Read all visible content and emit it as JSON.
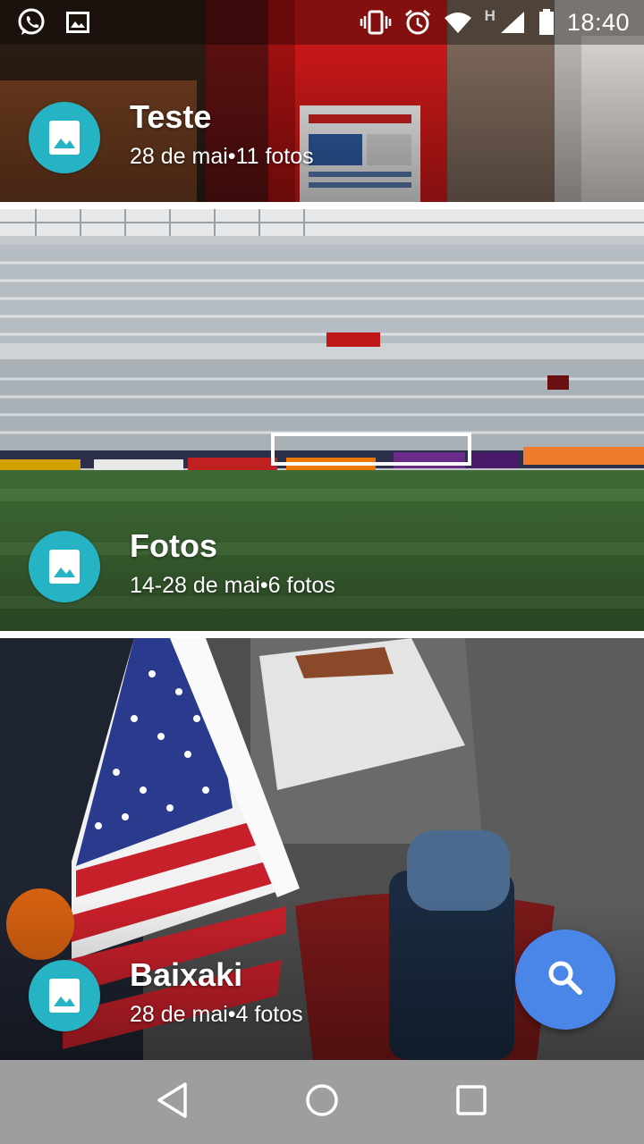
{
  "status_bar": {
    "time": "18:40",
    "network_type": "H",
    "left_icons": [
      "whatsapp-icon",
      "image-notification-icon"
    ],
    "right_icons": [
      "vibrate-icon",
      "alarm-icon",
      "wifi-icon",
      "signal-icon",
      "battery-icon"
    ]
  },
  "albums": [
    {
      "title": "Teste",
      "meta": "28 de mai•11 fotos",
      "icon": "album-image-icon"
    },
    {
      "title": "Fotos",
      "meta": "14-28 de mai•6 fotos",
      "icon": "album-image-icon"
    },
    {
      "title": "Baixaki",
      "meta": "28 de mai•4 fotos",
      "icon": "album-image-icon"
    }
  ],
  "fab": {
    "icon": "search-icon",
    "color": "#4a86e8"
  },
  "nav_bar": {
    "buttons": [
      "back-icon",
      "home-icon",
      "recents-icon"
    ]
  },
  "colors": {
    "album_icon_bg": "#26b3c4",
    "nav_bar_bg": "#9e9e9e"
  }
}
